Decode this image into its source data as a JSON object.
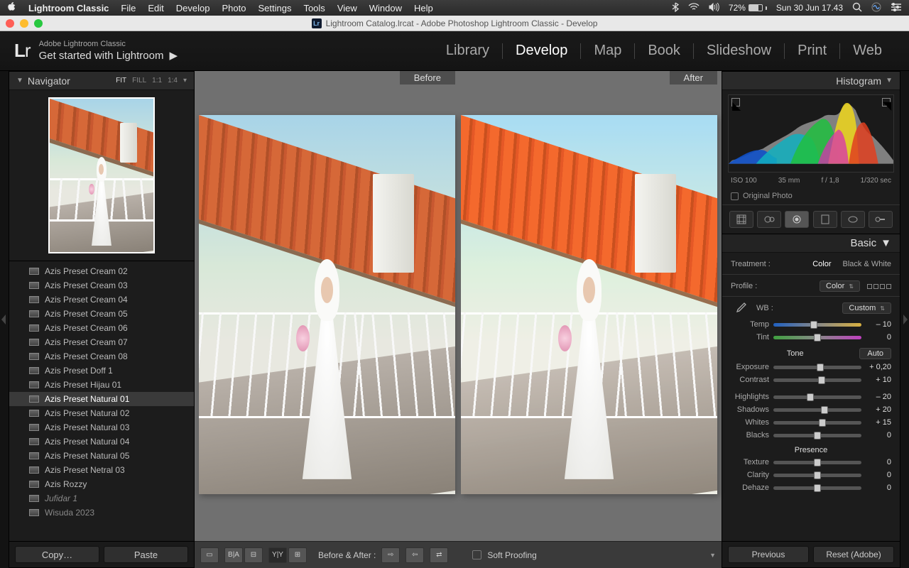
{
  "mac": {
    "app": "Lightroom Classic",
    "menu": [
      "File",
      "Edit",
      "Develop",
      "Photo",
      "Settings",
      "Tools",
      "View",
      "Window",
      "Help"
    ],
    "battery": "72%",
    "clock": "Sun 30 Jun  17.43"
  },
  "window": {
    "title": "Lightroom Catalog.lrcat - Adobe Photoshop Lightroom Classic - Develop"
  },
  "header": {
    "brand": "Adobe Lightroom Classic",
    "tagline": "Get started with Lightroom",
    "modules": [
      "Library",
      "Develop",
      "Map",
      "Book",
      "Slideshow",
      "Print",
      "Web"
    ],
    "active": "Develop"
  },
  "navigator": {
    "title": "Navigator",
    "opts": [
      "FIT",
      "FILL",
      "1:1",
      "1:4"
    ],
    "active": "FIT"
  },
  "presets": [
    {
      "label": "Azis Preset Cream 02"
    },
    {
      "label": "Azis Preset Cream 03"
    },
    {
      "label": "Azis Preset Cream 04"
    },
    {
      "label": "Azis Preset Cream 05"
    },
    {
      "label": "Azis Preset Cream 06"
    },
    {
      "label": "Azis Preset Cream 07"
    },
    {
      "label": "Azis Preset Cream 08"
    },
    {
      "label": "Azis Preset Doff 1"
    },
    {
      "label": "Azis Preset Hijau 01"
    },
    {
      "label": "Azis Preset Natural 01",
      "selected": true
    },
    {
      "label": "Azis Preset Natural 02"
    },
    {
      "label": "Azis Preset Natural 03"
    },
    {
      "label": "Azis Preset Natural 04"
    },
    {
      "label": "Azis Preset Natural 05"
    },
    {
      "label": "Azis Preset Netral 03"
    },
    {
      "label": "Azis Rozzy"
    },
    {
      "label": "Jufidar 1",
      "italic": true
    },
    {
      "label": "Wisuda 2023",
      "link": true
    }
  ],
  "left_footer": {
    "copy": "Copy…",
    "paste": "Paste"
  },
  "center": {
    "before": "Before",
    "after": "After",
    "toolbar_label": "Before & After :",
    "soft_proof": "Soft Proofing"
  },
  "right_footer": {
    "prev": "Previous",
    "reset": "Reset (Adobe)"
  },
  "histogram": {
    "title": "Histogram",
    "iso": "ISO 100",
    "fl": "35 mm",
    "ap": "f / 1,8",
    "ss": "1/320 sec",
    "original": "Original Photo"
  },
  "basic": {
    "title": "Basic",
    "treatment_label": "Treatment :",
    "treatment": {
      "color": "Color",
      "bw": "Black & White",
      "active": "Color"
    },
    "profile_label": "Profile :",
    "profile": "Color",
    "wb_label": "WB :",
    "wb": "Custom",
    "tone_label": "Tone",
    "auto": "Auto",
    "presence_label": "Presence",
    "sliders": {
      "temp": {
        "label": "Temp",
        "value": "– 10",
        "pos": 46
      },
      "tint": {
        "label": "Tint",
        "value": "0",
        "pos": 50
      },
      "exposure": {
        "label": "Exposure",
        "value": "+ 0,20",
        "pos": 53
      },
      "contrast": {
        "label": "Contrast",
        "value": "+ 10",
        "pos": 55
      },
      "highlights": {
        "label": "Highlights",
        "value": "– 20",
        "pos": 42
      },
      "shadows": {
        "label": "Shadows",
        "value": "+ 20",
        "pos": 58
      },
      "whites": {
        "label": "Whites",
        "value": "+ 15",
        "pos": 56
      },
      "blacks": {
        "label": "Blacks",
        "value": "0",
        "pos": 50
      },
      "texture": {
        "label": "Texture",
        "value": "0",
        "pos": 50
      },
      "clarity": {
        "label": "Clarity",
        "value": "0",
        "pos": 50
      },
      "dehaze": {
        "label": "Dehaze",
        "value": "0",
        "pos": 50
      }
    }
  }
}
